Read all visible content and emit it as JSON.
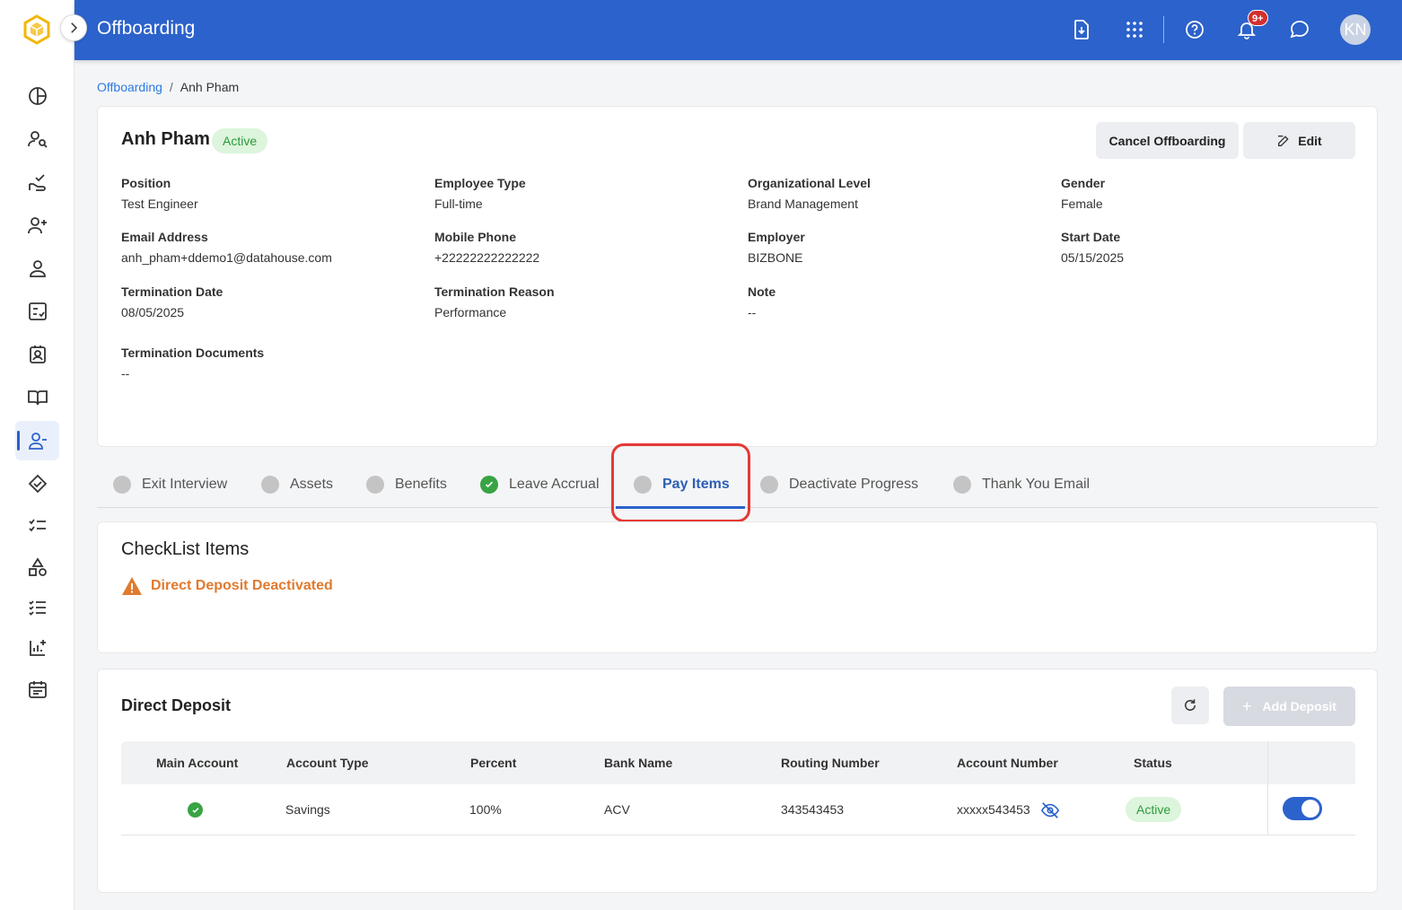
{
  "header": {
    "title": "Offboarding",
    "notification_count": "9+",
    "avatar_initials": "KN"
  },
  "breadcrumb": {
    "parent": "Offboarding",
    "separator": "/",
    "current": "Anh Pham"
  },
  "employee": {
    "name": "Anh Pham",
    "status": "Active",
    "cancel_label": "Cancel Offboarding",
    "edit_label": "Edit",
    "fields": [
      {
        "label": "Position",
        "value": "Test Engineer"
      },
      {
        "label": "Employee Type",
        "value": "Full-time"
      },
      {
        "label": "Organizational Level",
        "value": "Brand Management"
      },
      {
        "label": "Gender",
        "value": "Female"
      },
      {
        "label": "Email Address",
        "value": "anh_pham+ddemo1@datahouse.com"
      },
      {
        "label": "Mobile Phone",
        "value": "+22222222222222"
      },
      {
        "label": "Employer",
        "value": "BIZBONE"
      },
      {
        "label": "Start Date",
        "value": "05/15/2025"
      },
      {
        "label": "Termination Date",
        "value": "08/05/2025"
      },
      {
        "label": "Termination Reason",
        "value": "Performance"
      },
      {
        "label": "Note",
        "value": "--"
      },
      {
        "label": "Termination Documents",
        "value": "--"
      }
    ]
  },
  "tabs": [
    {
      "label": "Exit Interview",
      "state": "pending"
    },
    {
      "label": "Assets",
      "state": "pending"
    },
    {
      "label": "Benefits",
      "state": "pending"
    },
    {
      "label": "Leave Accrual",
      "state": "done"
    },
    {
      "label": "Pay Items",
      "state": "active"
    },
    {
      "label": "Deactivate Progress",
      "state": "pending"
    },
    {
      "label": "Thank You Email",
      "state": "pending"
    }
  ],
  "checklist": {
    "title": "CheckList Items",
    "warning": "Direct Deposit Deactivated",
    "warning_color": "#e07a2e"
  },
  "direct_deposit": {
    "title": "Direct Deposit",
    "add_label": "Add Deposit",
    "columns": [
      "Main Account",
      "Account Type",
      "Percent",
      "Bank Name",
      "Routing Number",
      "Account Number",
      "Status"
    ],
    "rows": [
      {
        "account_type": "Savings",
        "percent": "100%",
        "bank_name": "ACV",
        "routing_number": "343543453",
        "account_number": "xxxxx543453",
        "status": "Active"
      }
    ]
  },
  "colors": {
    "primary": "#2c62cb",
    "success": "#38a444",
    "highlight": "#e53935"
  }
}
